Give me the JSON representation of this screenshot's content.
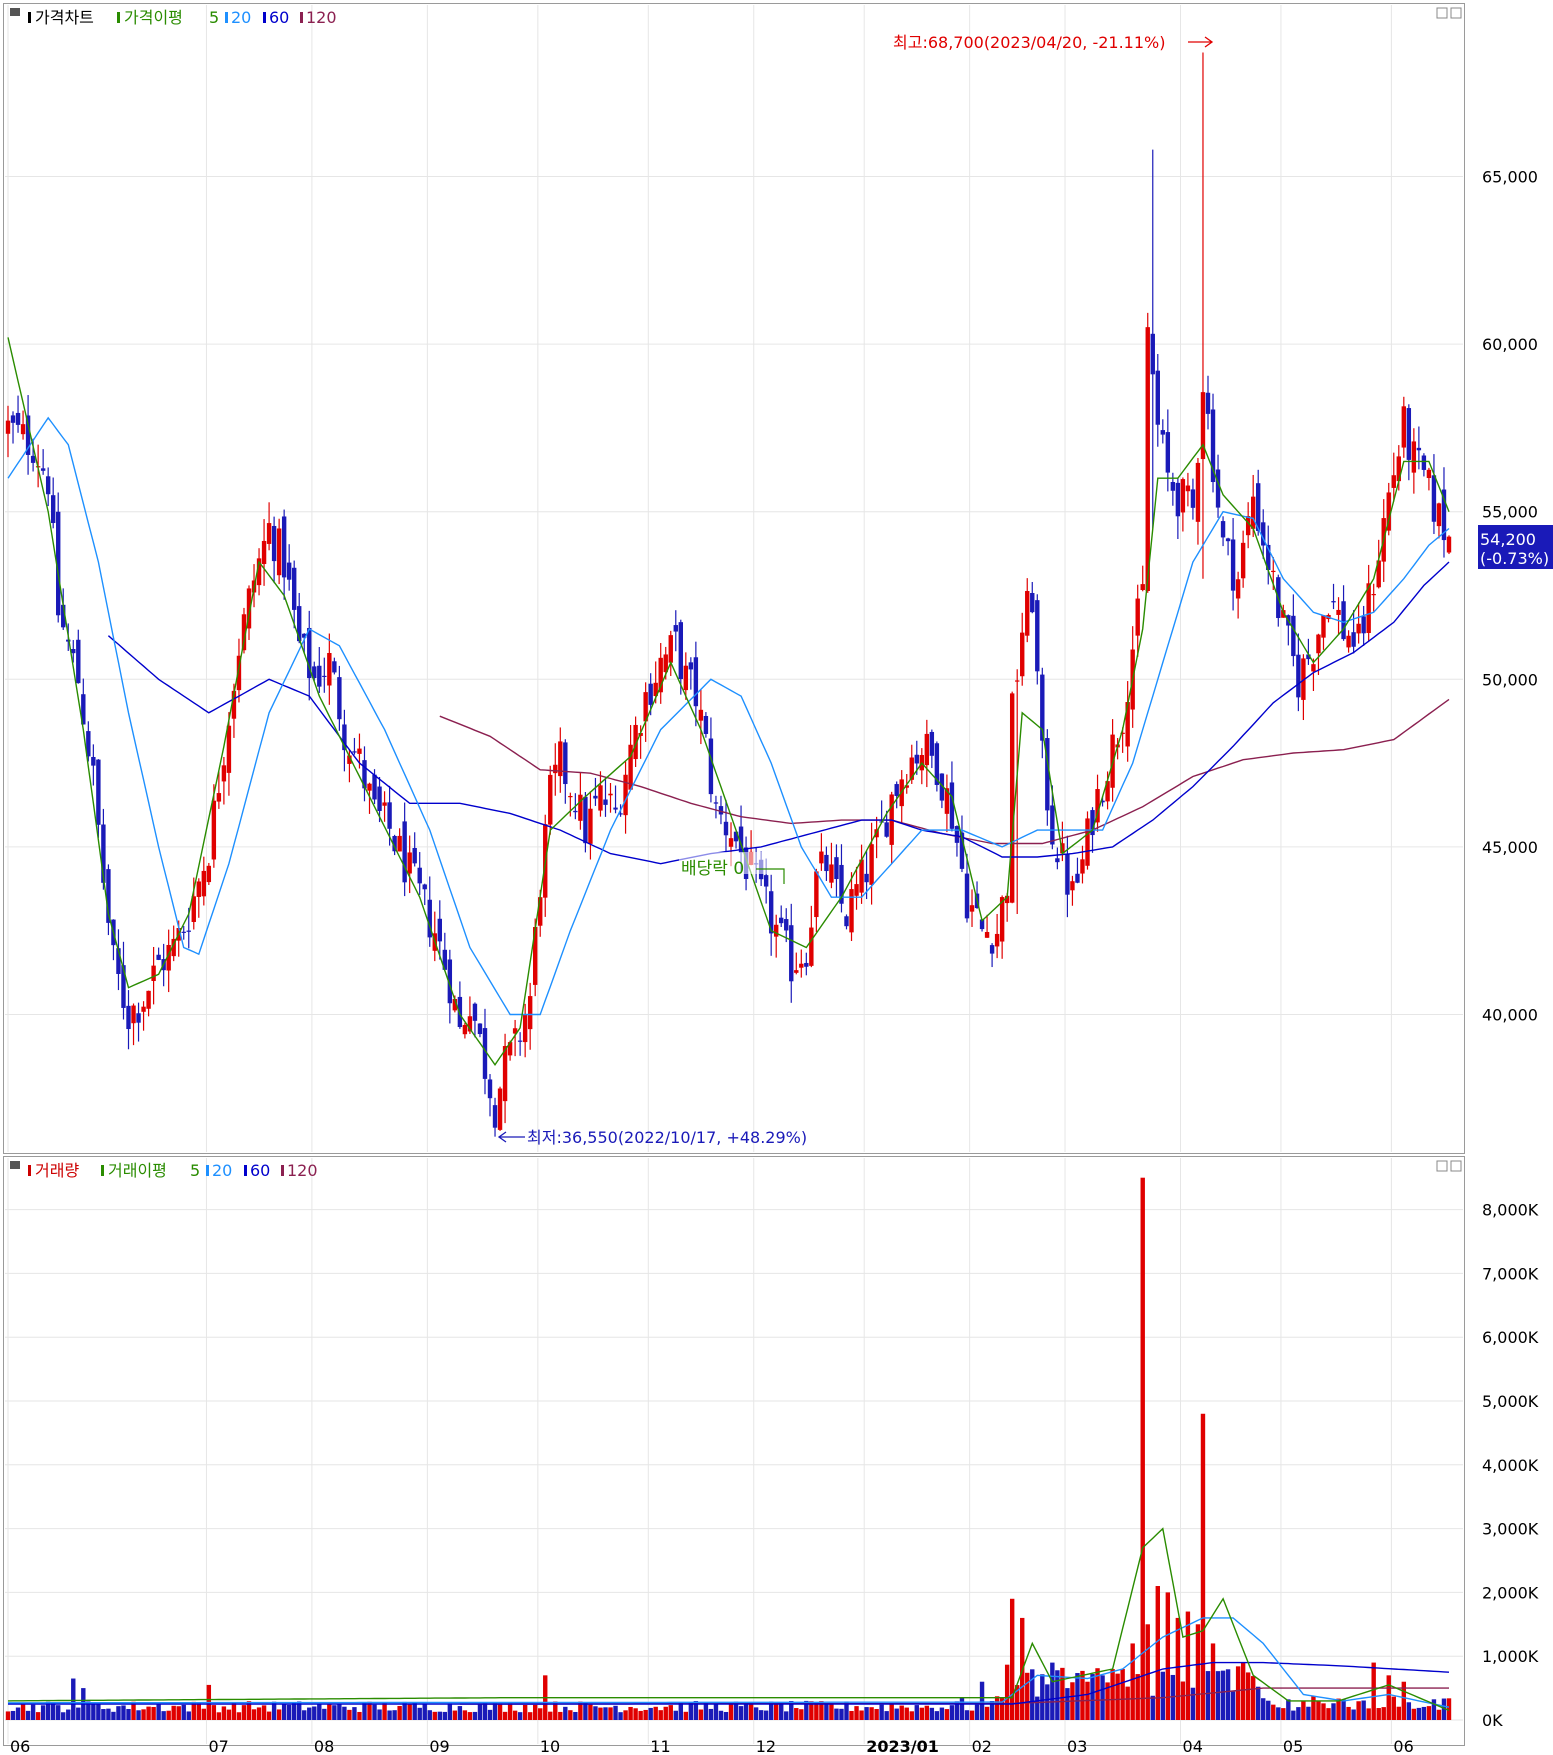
{
  "price_panel": {
    "legend": [
      {
        "text": "가격차트",
        "color": "#000000"
      },
      {
        "text": "가격이평",
        "color": "#2a8c00"
      },
      {
        "text": "5",
        "color": "#2a8c00"
      },
      {
        "text": "20",
        "color": "#1e90ff"
      },
      {
        "text": "60",
        "color": "#0000cc"
      },
      {
        "text": "120",
        "color": "#8b2050"
      }
    ],
    "high_annotation": "최고:68,700(2023/04/20, -21.11%)",
    "low_annotation": "최저:36,550(2022/10/17, +48.29%)",
    "event_annotation": "배당락 0",
    "current_price_label": "54,200",
    "current_change_label": "(-0.73%)",
    "y_tick_labels": [
      "65,000",
      "60,000",
      "55,000",
      "50,000",
      "45,000",
      "40,000"
    ]
  },
  "volume_panel": {
    "legend": [
      {
        "text": "거래량",
        "color": "#cc0000"
      },
      {
        "text": "거래이평",
        "color": "#2a8c00"
      },
      {
        "text": "5",
        "color": "#2a8c00"
      },
      {
        "text": "20",
        "color": "#1e90ff"
      },
      {
        "text": "60",
        "color": "#0000cc"
      },
      {
        "text": "120",
        "color": "#8b2050"
      }
    ],
    "y_tick_labels": [
      "8,000K",
      "7,000K",
      "6,000K",
      "5,000K",
      "4,000K",
      "3,000K",
      "2,000K",
      "1,000K",
      "0K"
    ]
  },
  "x_tick_labels": [
    "06",
    "07",
    "08",
    "09",
    "10",
    "11",
    "12",
    "2023/01",
    "02",
    "03",
    "04",
    "05",
    "06"
  ],
  "colors": {
    "up": "#e00000",
    "down": "#1a1ab8",
    "ma5": "#2a8c00",
    "ma20": "#1e90ff",
    "ma60": "#0000cc",
    "ma120": "#8b2050",
    "grid": "#e6e6e6"
  },
  "chart_data": [
    {
      "type": "candlestick",
      "x_range": [
        "2022-06",
        "2023-06"
      ],
      "ylim": [
        36000,
        69000
      ],
      "y_ticks": [
        40000,
        45000,
        50000,
        55000,
        60000,
        65000
      ],
      "grid": true,
      "high": {
        "value": 68700,
        "date": "2023/04/20"
      },
      "low": {
        "value": 36550,
        "date": "2022/10/17"
      },
      "last": {
        "value": 54200,
        "change_pct": -0.73
      },
      "anchors": [
        [
          0,
          57500
        ],
        [
          5,
          57000
        ],
        [
          8,
          56000
        ],
        [
          10,
          52000
        ],
        [
          14,
          50000
        ],
        [
          17,
          47000
        ],
        [
          19,
          44000
        ],
        [
          21,
          41500
        ],
        [
          24,
          40000
        ],
        [
          27,
          40500
        ],
        [
          30,
          41500
        ],
        [
          33,
          42000
        ],
        [
          36,
          43000
        ],
        [
          40,
          45000
        ],
        [
          43,
          48000
        ],
        [
          46,
          51000
        ],
        [
          49,
          53000
        ],
        [
          52,
          54500
        ],
        [
          55,
          53500
        ],
        [
          58,
          51000
        ],
        [
          61,
          50000
        ],
        [
          64,
          50500
        ],
        [
          67,
          48500
        ],
        [
          70,
          47500
        ],
        [
          73,
          46000
        ],
        [
          76,
          45500
        ],
        [
          79,
          44500
        ],
        [
          82,
          43500
        ],
        [
          85,
          42500
        ],
        [
          88,
          41000
        ],
        [
          90,
          39500
        ],
        [
          92,
          40500
        ],
        [
          95,
          38500
        ],
        [
          97,
          37300
        ],
        [
          99,
          38500
        ],
        [
          101,
          39000
        ],
        [
          104,
          40500
        ],
        [
          106,
          44000
        ],
        [
          108,
          46500
        ],
        [
          110,
          47500
        ],
        [
          113,
          46500
        ],
        [
          115,
          45500
        ],
        [
          118,
          46500
        ],
        [
          121,
          46000
        ],
        [
          124,
          48000
        ],
        [
          127,
          49500
        ],
        [
          130,
          50500
        ],
        [
          133,
          51000
        ],
        [
          135,
          50000
        ],
        [
          137,
          49500
        ],
        [
          139,
          48000
        ],
        [
          141,
          46000
        ],
        [
          144,
          45500
        ],
        [
          147,
          44500
        ],
        [
          150,
          43500
        ],
        [
          153,
          42500
        ],
        [
          156,
          41500
        ],
        [
          159,
          42000
        ],
        [
          161,
          44000
        ],
        [
          163,
          44500
        ],
        [
          165,
          43500
        ],
        [
          167,
          43000
        ],
        [
          170,
          44000
        ],
        [
          173,
          45000
        ],
        [
          176,
          46500
        ],
        [
          179,
          47500
        ],
        [
          182,
          48000
        ],
        [
          185,
          47500
        ],
        [
          188,
          46000
        ],
        [
          191,
          43500
        ],
        [
          194,
          42500
        ],
        [
          197,
          42500
        ],
        [
          199,
          44000
        ],
        [
          200,
          49000
        ],
        [
          202,
          51500
        ],
        [
          204,
          52500
        ],
        [
          206,
          47500
        ],
        [
          208,
          45500
        ],
        [
          210,
          44500
        ],
        [
          212,
          43500
        ],
        [
          214,
          44500
        ],
        [
          216,
          46000
        ],
        [
          218,
          47000
        ],
        [
          220,
          48000
        ],
        [
          222,
          49000
        ],
        [
          224,
          51000
        ],
        [
          226,
          52500
        ],
        [
          227,
          60500
        ],
        [
          229,
          57500
        ],
        [
          231,
          56000
        ],
        [
          233,
          55500
        ],
        [
          236,
          55000
        ],
        [
          238,
          59000
        ],
        [
          240,
          56500
        ],
        [
          242,
          54000
        ],
        [
          245,
          53000
        ],
        [
          248,
          55500
        ],
        [
          251,
          53500
        ],
        [
          254,
          51500
        ],
        [
          257,
          50000
        ],
        [
          260,
          51000
        ],
        [
          263,
          52500
        ],
        [
          266,
          51500
        ],
        [
          269,
          51000
        ],
        [
          272,
          53000
        ],
        [
          275,
          55500
        ],
        [
          278,
          57500
        ],
        [
          280,
          56500
        ],
        [
          282,
          56000
        ],
        [
          285,
          54800
        ],
        [
          287,
          54200
        ]
      ],
      "spikes": [
        [
          228,
          65800,
          54500
        ],
        [
          238,
          68700,
          53000
        ],
        [
          201,
          48800,
          43000
        ],
        [
          97,
          36550,
          36550
        ]
      ],
      "ma5_shape": [
        [
          0,
          60200
        ],
        [
          8,
          55000
        ],
        [
          15,
          48500
        ],
        [
          20,
          43000
        ],
        [
          24,
          40800
        ],
        [
          30,
          41200
        ],
        [
          36,
          43000
        ],
        [
          43,
          48000
        ],
        [
          50,
          53500
        ],
        [
          55,
          52500
        ],
        [
          62,
          49500
        ],
        [
          72,
          46500
        ],
        [
          82,
          43500
        ],
        [
          90,
          40000
        ],
        [
          97,
          38500
        ],
        [
          102,
          39600
        ],
        [
          108,
          45500
        ],
        [
          115,
          46500
        ],
        [
          124,
          47700
        ],
        [
          132,
          50500
        ],
        [
          138,
          48500
        ],
        [
          145,
          45500
        ],
        [
          152,
          42500
        ],
        [
          159,
          42000
        ],
        [
          166,
          43500
        ],
        [
          175,
          46000
        ],
        [
          182,
          47500
        ],
        [
          188,
          46500
        ],
        [
          194,
          42800
        ],
        [
          199,
          43500
        ],
        [
          202,
          49000
        ],
        [
          206,
          48500
        ],
        [
          210,
          44800
        ],
        [
          216,
          45500
        ],
        [
          222,
          48500
        ],
        [
          226,
          51500
        ],
        [
          229,
          56000
        ],
        [
          233,
          56000
        ],
        [
          238,
          57000
        ],
        [
          242,
          55500
        ],
        [
          248,
          54500
        ],
        [
          254,
          52000
        ],
        [
          260,
          50500
        ],
        [
          266,
          51500
        ],
        [
          272,
          53000
        ],
        [
          278,
          56500
        ],
        [
          283,
          56500
        ],
        [
          287,
          55000
        ]
      ],
      "ma20_shape": [
        [
          0,
          56000
        ],
        [
          8,
          57800
        ],
        [
          12,
          57000
        ],
        [
          18,
          53500
        ],
        [
          24,
          49000
        ],
        [
          30,
          45000
        ],
        [
          35,
          42000
        ],
        [
          38,
          41800
        ],
        [
          44,
          44500
        ],
        [
          52,
          49000
        ],
        [
          60,
          51500
        ],
        [
          66,
          51000
        ],
        [
          75,
          48500
        ],
        [
          84,
          45500
        ],
        [
          92,
          42000
        ],
        [
          100,
          40000
        ],
        [
          106,
          40000
        ],
        [
          112,
          42500
        ],
        [
          120,
          45500
        ],
        [
          130,
          48500
        ],
        [
          140,
          50000
        ],
        [
          146,
          49500
        ],
        [
          152,
          47500
        ],
        [
          158,
          45000
        ],
        [
          164,
          43500
        ],
        [
          170,
          43500
        ],
        [
          176,
          44500
        ],
        [
          182,
          45500
        ],
        [
          190,
          45500
        ],
        [
          198,
          45000
        ],
        [
          205,
          45500
        ],
        [
          212,
          45500
        ],
        [
          218,
          45500
        ],
        [
          224,
          47500
        ],
        [
          230,
          50500
        ],
        [
          236,
          53500
        ],
        [
          242,
          55000
        ],
        [
          248,
          54800
        ],
        [
          254,
          53000
        ],
        [
          260,
          52000
        ],
        [
          266,
          51700
        ],
        [
          272,
          52000
        ],
        [
          278,
          53000
        ],
        [
          283,
          54000
        ],
        [
          287,
          54500
        ]
      ],
      "ma60_shape": [
        [
          20,
          51300
        ],
        [
          30,
          50000
        ],
        [
          40,
          49000
        ],
        [
          52,
          50000
        ],
        [
          60,
          49500
        ],
        [
          70,
          47500
        ],
        [
          80,
          46300
        ],
        [
          90,
          46300
        ],
        [
          100,
          46000
        ],
        [
          110,
          45500
        ],
        [
          120,
          44800
        ],
        [
          130,
          44500
        ],
        [
          140,
          44800
        ],
        [
          150,
          45000
        ],
        [
          160,
          45400
        ],
        [
          170,
          45800
        ],
        [
          176,
          45800
        ],
        [
          182,
          45500
        ],
        [
          190,
          45300
        ],
        [
          198,
          44700
        ],
        [
          205,
          44700
        ],
        [
          212,
          44800
        ],
        [
          220,
          45000
        ],
        [
          228,
          45800
        ],
        [
          236,
          46800
        ],
        [
          244,
          48000
        ],
        [
          252,
          49300
        ],
        [
          260,
          50200
        ],
        [
          268,
          50800
        ],
        [
          276,
          51700
        ],
        [
          282,
          52800
        ],
        [
          287,
          53500
        ]
      ],
      "ma120_shape": [
        [
          86,
          48900
        ],
        [
          96,
          48300
        ],
        [
          106,
          47300
        ],
        [
          116,
          47200
        ],
        [
          126,
          46800
        ],
        [
          136,
          46300
        ],
        [
          146,
          45900
        ],
        [
          156,
          45700
        ],
        [
          166,
          45800
        ],
        [
          176,
          45800
        ],
        [
          186,
          45400
        ],
        [
          196,
          45100
        ],
        [
          206,
          45100
        ],
        [
          216,
          45500
        ],
        [
          226,
          46200
        ],
        [
          236,
          47100
        ],
        [
          246,
          47600
        ],
        [
          256,
          47800
        ],
        [
          266,
          47900
        ],
        [
          276,
          48200
        ],
        [
          287,
          49400
        ]
      ]
    },
    {
      "type": "bar",
      "series": [
        {
          "values_k": "daily volume"
        }
      ],
      "ylim": [
        0,
        8700
      ],
      "y_ticks": [
        0,
        1000,
        2000,
        3000,
        4000,
        5000,
        6000,
        7000,
        8000
      ],
      "base_volume_k": 200,
      "big_volumes_k": [
        [
          226,
          8500
        ],
        [
          238,
          4800
        ],
        [
          200,
          1900
        ],
        [
          202,
          1600
        ],
        [
          229,
          2100
        ],
        [
          231,
          2000
        ],
        [
          233,
          1600
        ],
        [
          235,
          1700
        ],
        [
          237,
          1500
        ],
        [
          240,
          1200
        ],
        [
          227,
          1500
        ],
        [
          224,
          1200
        ],
        [
          222,
          800
        ],
        [
          218,
          700
        ],
        [
          215,
          600
        ],
        [
          211,
          500
        ],
        [
          194,
          600
        ],
        [
          190,
          350
        ],
        [
          13,
          650
        ],
        [
          15,
          500
        ],
        [
          40,
          550
        ],
        [
          107,
          700
        ],
        [
          272,
          900
        ],
        [
          275,
          700
        ],
        [
          278,
          600
        ]
      ],
      "ma5_shape": [
        [
          0,
          300
        ],
        [
          100,
          350
        ],
        [
          200,
          350
        ],
        [
          204,
          1200
        ],
        [
          208,
          600
        ],
        [
          220,
          800
        ],
        [
          226,
          2700
        ],
        [
          230,
          3000
        ],
        [
          234,
          1300
        ],
        [
          238,
          1400
        ],
        [
          242,
          1900
        ],
        [
          248,
          700
        ],
        [
          255,
          300
        ],
        [
          265,
          300
        ],
        [
          275,
          550
        ],
        [
          287,
          150
        ]
      ],
      "ma20_shape": [
        [
          0,
          270
        ],
        [
          198,
          280
        ],
        [
          205,
          700
        ],
        [
          215,
          650
        ],
        [
          222,
          800
        ],
        [
          230,
          1300
        ],
        [
          238,
          1600
        ],
        [
          244,
          1600
        ],
        [
          250,
          1200
        ],
        [
          258,
          400
        ],
        [
          266,
          300
        ],
        [
          275,
          400
        ],
        [
          287,
          200
        ]
      ],
      "ma60_shape": [
        [
          0,
          250
        ],
        [
          200,
          250
        ],
        [
          215,
          400
        ],
        [
          230,
          800
        ],
        [
          240,
          900
        ],
        [
          250,
          900
        ],
        [
          265,
          850
        ],
        [
          287,
          750
        ]
      ],
      "ma120_shape": [
        [
          90,
          250
        ],
        [
          200,
          260
        ],
        [
          230,
          350
        ],
        [
          250,
          500
        ],
        [
          287,
          500
        ]
      ]
    }
  ]
}
